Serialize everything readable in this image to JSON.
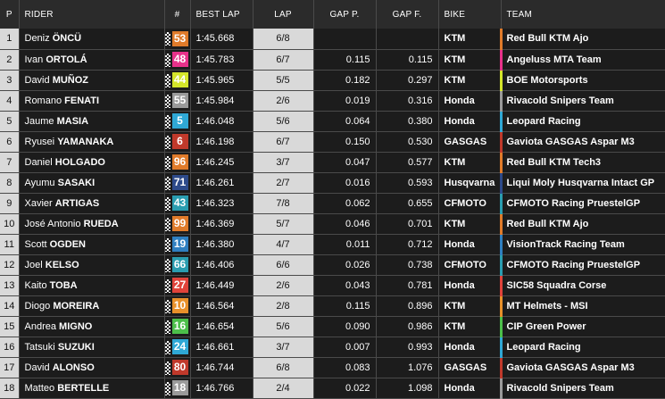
{
  "headers": {
    "pos": "P",
    "rider": "RIDER",
    "num": "#",
    "best_lap": "BEST LAP",
    "lap": "LAP",
    "gap_p": "GAP P.",
    "gap_f": "GAP F.",
    "bike": "BIKE",
    "team": "TEAM"
  },
  "rows": [
    {
      "pos": "1",
      "first": "Deniz",
      "last": "ÖNCÜ",
      "num": "53",
      "num_color": "#e07b2a",
      "best": "1:45.668",
      "lap": "6/8",
      "gap_p": "",
      "gap_f": "",
      "bike": "KTM",
      "team": "Red Bull KTM Ajo",
      "team_color": "#e07b2a"
    },
    {
      "pos": "2",
      "first": "Ivan",
      "last": "ORTOLÁ",
      "num": "48",
      "num_color": "#e8318a",
      "best": "1:45.783",
      "lap": "6/7",
      "gap_p": "0.115",
      "gap_f": "0.115",
      "bike": "KTM",
      "team": "Angeluss MTA Team",
      "team_color": "#e8318a"
    },
    {
      "pos": "3",
      "first": "David",
      "last": "MUÑOZ",
      "num": "44",
      "num_color": "#d4e52a",
      "best": "1:45.965",
      "lap": "5/5",
      "gap_p": "0.182",
      "gap_f": "0.297",
      "bike": "KTM",
      "team": "BOE Motorsports",
      "team_color": "#d4e52a"
    },
    {
      "pos": "4",
      "first": "Romano",
      "last": "FENATI",
      "num": "55",
      "num_color": "#9a9a9a",
      "best": "1:45.984",
      "lap": "2/6",
      "gap_p": "0.019",
      "gap_f": "0.316",
      "bike": "Honda",
      "team": "Rivacold Snipers Team",
      "team_color": "#9a9a9a"
    },
    {
      "pos": "5",
      "first": "Jaume",
      "last": "MASIA",
      "num": "5",
      "num_color": "#2fa8d5",
      "best": "1:46.048",
      "lap": "5/6",
      "gap_p": "0.064",
      "gap_f": "0.380",
      "bike": "Honda",
      "team": "Leopard Racing",
      "team_color": "#2fa8d5"
    },
    {
      "pos": "6",
      "first": "Ryusei",
      "last": "YAMANAKA",
      "num": "6",
      "num_color": "#c0392b",
      "best": "1:46.198",
      "lap": "6/7",
      "gap_p": "0.150",
      "gap_f": "0.530",
      "bike": "GASGAS",
      "team": "Gaviota GASGAS Aspar M3",
      "team_color": "#c0392b"
    },
    {
      "pos": "7",
      "first": "Daniel",
      "last": "HOLGADO",
      "num": "96",
      "num_color": "#e07b2a",
      "best": "1:46.245",
      "lap": "3/7",
      "gap_p": "0.047",
      "gap_f": "0.577",
      "bike": "KTM",
      "team": "Red Bull KTM Tech3",
      "team_color": "#e07b2a"
    },
    {
      "pos": "8",
      "first": "Ayumu",
      "last": "SASAKI",
      "num": "71",
      "num_color": "#2d4a8a",
      "best": "1:46.261",
      "lap": "2/7",
      "gap_p": "0.016",
      "gap_f": "0.593",
      "bike": "Husqvarna",
      "team": "Liqui Moly Husqvarna Intact GP",
      "team_color": "#2d4a8a"
    },
    {
      "pos": "9",
      "first": "Xavier",
      "last": "ARTIGAS",
      "num": "43",
      "num_color": "#2a9db0",
      "best": "1:46.323",
      "lap": "7/8",
      "gap_p": "0.062",
      "gap_f": "0.655",
      "bike": "CFMOTO",
      "team": "CFMOTO Racing PruestelGP",
      "team_color": "#2a9db0"
    },
    {
      "pos": "10",
      "first": "José Antonio",
      "last": "RUEDA",
      "num": "99",
      "num_color": "#e07b2a",
      "best": "1:46.369",
      "lap": "5/7",
      "gap_p": "0.046",
      "gap_f": "0.701",
      "bike": "KTM",
      "team": "Red Bull KTM Ajo",
      "team_color": "#e07b2a"
    },
    {
      "pos": "11",
      "first": "Scott",
      "last": "OGDEN",
      "num": "19",
      "num_color": "#2f7fc0",
      "best": "1:46.380",
      "lap": "4/7",
      "gap_p": "0.011",
      "gap_f": "0.712",
      "bike": "Honda",
      "team": "VisionTrack Racing Team",
      "team_color": "#2f7fc0"
    },
    {
      "pos": "12",
      "first": "Joel",
      "last": "KELSO",
      "num": "66",
      "num_color": "#2a9db0",
      "best": "1:46.406",
      "lap": "6/6",
      "gap_p": "0.026",
      "gap_f": "0.738",
      "bike": "CFMOTO",
      "team": "CFMOTO Racing PruestelGP",
      "team_color": "#2a9db0"
    },
    {
      "pos": "13",
      "first": "Kaito",
      "last": "TOBA",
      "num": "27",
      "num_color": "#e0433a",
      "best": "1:46.449",
      "lap": "2/6",
      "gap_p": "0.043",
      "gap_f": "0.781",
      "bike": "Honda",
      "team": "SIC58 Squadra Corse",
      "team_color": "#e0433a"
    },
    {
      "pos": "14",
      "first": "Diogo",
      "last": "MOREIRA",
      "num": "10",
      "num_color": "#e8902a",
      "best": "1:46.564",
      "lap": "2/8",
      "gap_p": "0.115",
      "gap_f": "0.896",
      "bike": "KTM",
      "team": "MT Helmets - MSI",
      "team_color": "#e8902a"
    },
    {
      "pos": "15",
      "first": "Andrea",
      "last": "MIGNO",
      "num": "16",
      "num_color": "#4cbf4a",
      "best": "1:46.654",
      "lap": "5/6",
      "gap_p": "0.090",
      "gap_f": "0.986",
      "bike": "KTM",
      "team": "CIP Green Power",
      "team_color": "#4cbf4a"
    },
    {
      "pos": "16",
      "first": "Tatsuki",
      "last": "SUZUKI",
      "num": "24",
      "num_color": "#2fa8d5",
      "best": "1:46.661",
      "lap": "3/7",
      "gap_p": "0.007",
      "gap_f": "0.993",
      "bike": "Honda",
      "team": "Leopard Racing",
      "team_color": "#2fa8d5"
    },
    {
      "pos": "17",
      "first": "David",
      "last": "ALONSO",
      "num": "80",
      "num_color": "#c0392b",
      "best": "1:46.744",
      "lap": "6/8",
      "gap_p": "0.083",
      "gap_f": "1.076",
      "bike": "GASGAS",
      "team": "Gaviota GASGAS Aspar M3",
      "team_color": "#c0392b"
    },
    {
      "pos": "18",
      "first": "Matteo",
      "last": "BERTELLE",
      "num": "18",
      "num_color": "#9a9a9a",
      "best": "1:46.766",
      "lap": "2/4",
      "gap_p": "0.022",
      "gap_f": "1.098",
      "bike": "Honda",
      "team": "Rivacold Snipers Team",
      "team_color": "#9a9a9a"
    }
  ]
}
